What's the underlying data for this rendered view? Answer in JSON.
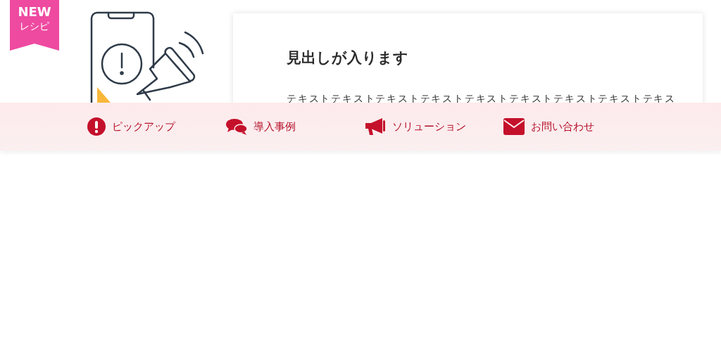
{
  "ribbon": {
    "title": "NEW",
    "subtitle": "レシピ"
  },
  "card": {
    "heading": "見出しが入ります",
    "body": "テキストテキストテキストテキストテキストテキストテキストテキストテキス"
  },
  "nav": [
    {
      "kind": "pickup",
      "label": "ピックアップ"
    },
    {
      "kind": "cases",
      "label": "導入事例"
    },
    {
      "kind": "solution",
      "label": "ソリューション"
    },
    {
      "kind": "contact",
      "label": "お問い合わせ"
    }
  ]
}
